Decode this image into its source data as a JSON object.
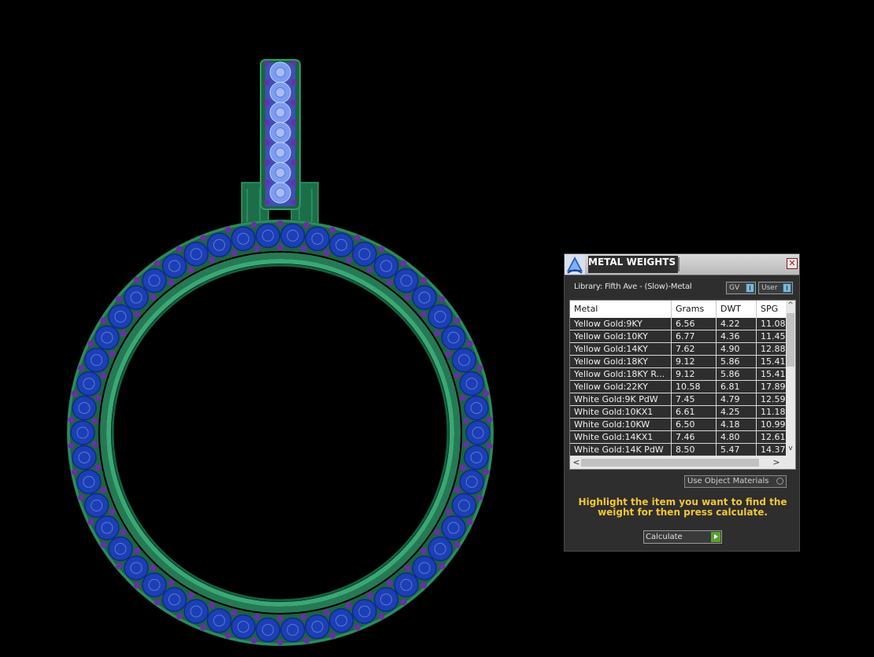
{
  "panel": {
    "title": "METAL WEIGHTS",
    "close_symbol": "✕",
    "library_label": "Library: Fifth Ave - (Slow)-Metal",
    "toggle_gv": "GV",
    "toggle_user": "User",
    "use_object_materials": "Use Object Materials",
    "instructions": "Highlight the item you want to find the weight for then press calculate.",
    "calculate_label": "Calculate",
    "scroll_up": "^",
    "scroll_down": "v",
    "scroll_left": "<",
    "scroll_right": ">"
  },
  "table": {
    "headers": [
      "Metal",
      "Grams",
      "DWT",
      "SPG"
    ],
    "rows": [
      [
        "Yellow Gold:9KY",
        "6.56",
        "4.22",
        "11.08"
      ],
      [
        "Yellow Gold:10KY",
        "6.77",
        "4.36",
        "11.45"
      ],
      [
        "Yellow Gold:14KY",
        "7.62",
        "4.90",
        "12.88"
      ],
      [
        "Yellow Gold:18KY",
        "9.12",
        "5.86",
        "15.41"
      ],
      [
        "Yellow Gold:18KY R...",
        "9.12",
        "5.86",
        "15.41"
      ],
      [
        "Yellow Gold:22KY",
        "10.58",
        "6.81",
        "17.89"
      ],
      [
        "White Gold:9K PdW",
        "7.45",
        "4.79",
        "12.59"
      ],
      [
        "White Gold:10KX1",
        "6.61",
        "4.25",
        "11.18"
      ],
      [
        "White Gold:10KW",
        "6.50",
        "4.18",
        "10.99"
      ],
      [
        "White Gold:14KX1",
        "7.46",
        "4.80",
        "12.61"
      ],
      [
        "White Gold:14K PdW",
        "8.50",
        "5.47",
        "14.37"
      ]
    ]
  },
  "colors": {
    "metal_green": "#1f7a52",
    "stone_blue": "#1d3fb5",
    "prong_purple": "#6a2fa6",
    "bail_stone": "#7e9cf0",
    "instruction_yellow": "#f3c637"
  },
  "icons": {
    "title_logo": "matrix-logo-icon",
    "close": "close-icon",
    "calculate": "play-arrow-icon"
  }
}
